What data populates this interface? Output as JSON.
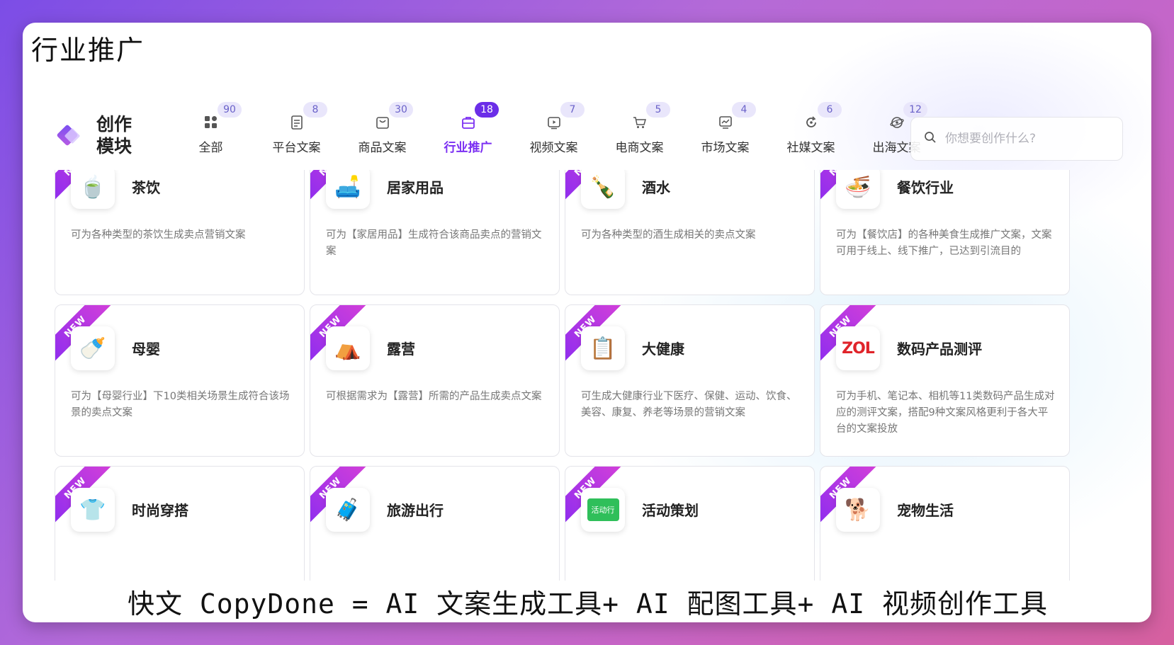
{
  "corner_title": "行业推广",
  "brand": {
    "line1": "创作",
    "line2": "模块"
  },
  "tabs": [
    {
      "label": "全部",
      "count": "90",
      "icon": "grid-icon",
      "active": false
    },
    {
      "label": "平台文案",
      "count": "8",
      "icon": "document-icon",
      "active": false
    },
    {
      "label": "商品文案",
      "count": "30",
      "icon": "shopping-bag-icon",
      "active": false
    },
    {
      "label": "行业推广",
      "count": "18",
      "icon": "briefcase-icon",
      "active": true
    },
    {
      "label": "视频文案",
      "count": "7",
      "icon": "video-icon",
      "active": false
    },
    {
      "label": "电商文案",
      "count": "5",
      "icon": "cart-icon",
      "active": false
    },
    {
      "label": "市场文案",
      "count": "4",
      "icon": "chart-icon",
      "active": false
    },
    {
      "label": "社媒文案",
      "count": "6",
      "icon": "refresh-icon",
      "active": false
    },
    {
      "label": "出海文案",
      "count": "12",
      "icon": "globe-icon",
      "active": false
    }
  ],
  "search": {
    "placeholder": "你想要创作什么?"
  },
  "cards": [
    {
      "title": "茶饮",
      "desc": "可为各种类型的茶饮生成卖点营销文案",
      "icon": "tea-cup-icon",
      "emoji": "🍵"
    },
    {
      "title": "居家用品",
      "desc": "可为【家居用品】生成符合该商品卖点的营销文案",
      "icon": "home-goods-icon",
      "emoji": "🛋️"
    },
    {
      "title": "酒水",
      "desc": "可为各种类型的酒生成相关的卖点文案",
      "icon": "wine-icon",
      "emoji": "🍾"
    },
    {
      "title": "餐饮行业",
      "desc": "可为【餐饮店】的各种美食生成推广文案，文案可用于线上、线下推广，已达到引流目的",
      "icon": "noodle-bowl-icon",
      "emoji": "🍜"
    },
    {
      "title": "母婴",
      "desc": "可为【母婴行业】下10类相关场景生成符合该场景的卖点文案",
      "icon": "baby-bottle-icon",
      "emoji": "🍼"
    },
    {
      "title": "露营",
      "desc": "可根据需求为【露营】所需的产品生成卖点文案",
      "icon": "tent-icon",
      "emoji": "⛺"
    },
    {
      "title": "大健康",
      "desc": "可生成大健康行业下医疗、保健、运动、饮食、美容、康复、养老等场景的营销文案",
      "icon": "health-report-icon",
      "emoji": "📋"
    },
    {
      "title": "数码产品测评",
      "desc": "可为手机、笔记本、相机等11类数码产品生成对应的测评文案，搭配9种文案风格更利于各大平台的文案投放",
      "icon": "zol-logo-icon",
      "logo_text": "ZOL"
    },
    {
      "title": "时尚穿搭",
      "desc": "",
      "icon": "clothes-icon",
      "emoji": "👕"
    },
    {
      "title": "旅游出行",
      "desc": "",
      "icon": "luggage-icon",
      "emoji": "🧳"
    },
    {
      "title": "活动策划",
      "desc": "",
      "icon": "event-plan-icon",
      "logo_text": "活动行"
    },
    {
      "title": "宠物生活",
      "desc": "",
      "icon": "dog-icon",
      "emoji": "🐕"
    }
  ],
  "ribbon_text": "NEW",
  "footer": "快文 CopyDone = AI 文案生成工具+ AI 配图工具+ AI 视频创作工具",
  "colors": {
    "accent": "#7b2ff2",
    "badge_bg": "#e9e6fb",
    "ribbon": "#b03ae6"
  }
}
